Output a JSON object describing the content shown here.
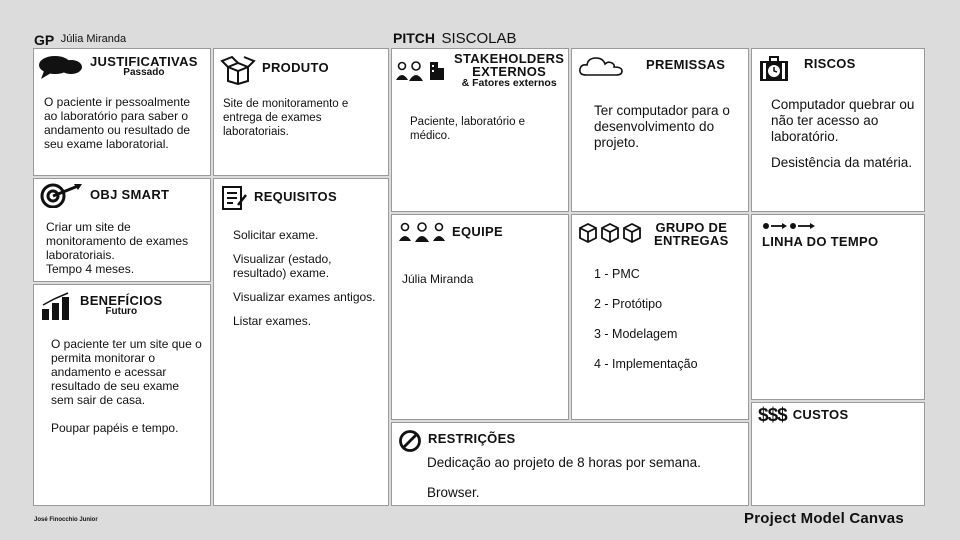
{
  "header": {
    "gp_label": "GP",
    "gp_name": "Júlia Miranda",
    "pitch_label": "PITCH",
    "pitch_value": "SISCOLAB"
  },
  "justificativas": {
    "title": "JUSTIFICATIVAS",
    "subtitle": "Passado",
    "text": "O paciente ir pessoalmente ao laboratório para saber o andamento ou resultado de seu exame laboratorial."
  },
  "produto": {
    "title": "PRODUTO",
    "text": "Site de monitoramento e entrega de exames laboratoriais."
  },
  "stakeholders": {
    "title1": "STAKEHOLDERS",
    "title2": "EXTERNOS",
    "title3": "& Fatores externos",
    "text": "Paciente, laboratório e médico."
  },
  "premissas": {
    "title": "PREMISSAS",
    "text": "Ter computador para o desenvolvimento do projeto."
  },
  "riscos": {
    "title": "RISCOS",
    "items": [
      "Computador quebrar ou não ter acesso ao laboratório.",
      "Desistência da matéria."
    ]
  },
  "obj_smart": {
    "title": "OBJ SMART",
    "text1": "Criar um site de monitoramento de exames laboratoriais.",
    "text2": "Tempo 4 meses."
  },
  "requisitos": {
    "title": "REQUISITOS",
    "items": [
      "Solicitar exame.",
      "Visualizar (estado, resultado) exame.",
      "Visualizar exames antigos.",
      "Listar exames."
    ]
  },
  "equipe": {
    "title": "EQUIPE",
    "text": "Júlia Miranda"
  },
  "entregas": {
    "title1": "GRUPO DE",
    "title2": "ENTREGAS",
    "items": [
      "1 - PMC",
      "2 - Protótipo",
      "3 - Modelagem",
      "4 - Implementação"
    ]
  },
  "linha_tempo": {
    "title": "LINHA DO TEMPO"
  },
  "beneficios": {
    "title": "BENEFÍCIOS",
    "subtitle": "Futuro",
    "items": [
      "O paciente ter um site que o permita monitorar o andamento e acessar resultado de seu exame sem sair de casa.",
      "Poupar papéis e tempo."
    ]
  },
  "restricoes": {
    "title": "RESTRIÇÕES",
    "items": [
      "Dedicação ao projeto de 8 horas por semana.",
      "Browser."
    ]
  },
  "custos": {
    "title": "CUSTOS",
    "symbol": "$$$"
  },
  "footer": {
    "author": "José Finocchio Junior",
    "brand": "Project Model Canvas"
  }
}
